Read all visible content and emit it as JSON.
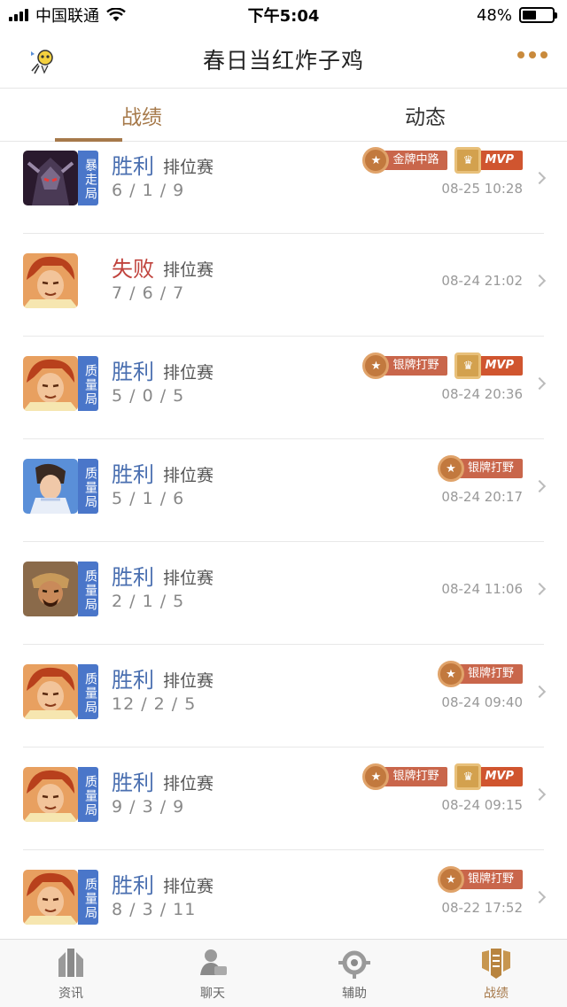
{
  "status": {
    "carrier": "中国联通",
    "time": "下午5:04",
    "battery": "48%",
    "battery_level": 0.48
  },
  "nav": {
    "title": "春日当红炸子鸡"
  },
  "tabs": [
    {
      "label": "战绩",
      "active": true
    },
    {
      "label": "动态",
      "active": false
    }
  ],
  "matches": [
    {
      "hero": "dark-knight-hero",
      "tag": "暴走局",
      "result": "胜利",
      "outcome": "win",
      "mode": "排位赛",
      "kda": "6 / 1 / 9",
      "time": "08-25 10:28",
      "badges": [
        {
          "label": "金牌中路",
          "kind": "gold"
        },
        {
          "label": "MVP",
          "kind": "mvp"
        }
      ]
    },
    {
      "hero": "red-hair-hero",
      "tag": "",
      "result": "失败",
      "outcome": "lose",
      "mode": "排位赛",
      "kda": "7 / 6 / 7",
      "time": "08-24 21:02",
      "badges": []
    },
    {
      "hero": "red-hair-hero",
      "tag": "质量局",
      "result": "胜利",
      "outcome": "win",
      "mode": "排位赛",
      "kda": "5 / 0 / 5",
      "time": "08-24 20:36",
      "badges": [
        {
          "label": "银牌打野",
          "kind": "silver"
        },
        {
          "label": "MVP",
          "kind": "mvp"
        }
      ]
    },
    {
      "hero": "blue-armor-hero",
      "tag": "质量局",
      "result": "胜利",
      "outcome": "win",
      "mode": "排位赛",
      "kda": "5 / 1 / 6",
      "time": "08-24 20:17",
      "badges": [
        {
          "label": "银牌打野",
          "kind": "silver"
        }
      ]
    },
    {
      "hero": "warrior-hero",
      "tag": "质量局",
      "result": "胜利",
      "outcome": "win",
      "mode": "排位赛",
      "kda": "2 / 1 / 5",
      "time": "08-24 11:06",
      "badges": []
    },
    {
      "hero": "red-hair-hero",
      "tag": "质量局",
      "result": "胜利",
      "outcome": "win",
      "mode": "排位赛",
      "kda": "12 / 2 / 5",
      "time": "08-24 09:40",
      "badges": [
        {
          "label": "银牌打野",
          "kind": "silver"
        }
      ]
    },
    {
      "hero": "red-hair-hero",
      "tag": "质量局",
      "result": "胜利",
      "outcome": "win",
      "mode": "排位赛",
      "kda": "9 / 3 / 9",
      "time": "08-24 09:15",
      "badges": [
        {
          "label": "银牌打野",
          "kind": "silver"
        },
        {
          "label": "MVP",
          "kind": "mvp"
        }
      ]
    },
    {
      "hero": "red-hair-hero",
      "tag": "质量局",
      "result": "胜利",
      "outcome": "win",
      "mode": "排位赛",
      "kda": "8 / 3 / 11",
      "time": "08-22 17:52",
      "badges": [
        {
          "label": "银牌打野",
          "kind": "silver"
        }
      ]
    }
  ],
  "tabbar": [
    {
      "label": "资讯",
      "icon": "news-icon",
      "active": false
    },
    {
      "label": "聊天",
      "icon": "chat-icon",
      "active": false
    },
    {
      "label": "辅助",
      "icon": "assist-icon",
      "active": false
    },
    {
      "label": "战绩",
      "icon": "record-icon",
      "active": true
    }
  ],
  "colors": {
    "accent": "#a6794a",
    "win": "#4a6fb0",
    "lose": "#c0433d",
    "tag": "#4a76c9"
  }
}
